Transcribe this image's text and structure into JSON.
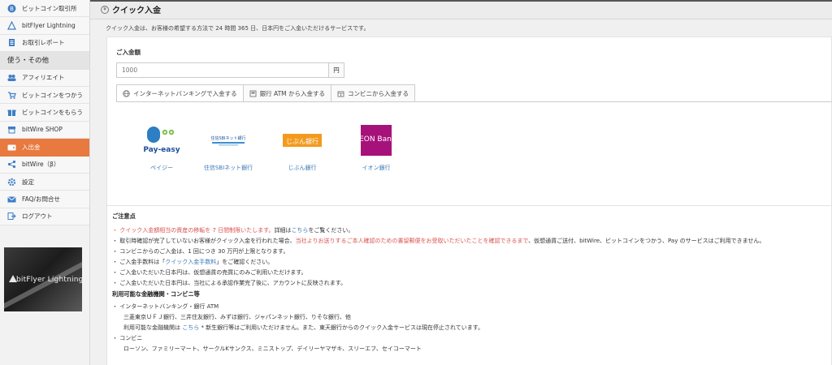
{
  "header": {
    "title": "クイック入金"
  },
  "sidebar": {
    "items": [
      {
        "label": "ビットコイン取引所",
        "icon": "bitcoin-icon"
      },
      {
        "label": "bitFlyer Lightning",
        "icon": "triangle-logo-icon"
      },
      {
        "label": "お取引レポート",
        "icon": "report-icon"
      },
      {
        "label": "使う・その他",
        "section": true
      },
      {
        "label": "アフィリエイト",
        "icon": "users-icon"
      },
      {
        "label": "ビットコインをつかう",
        "icon": "cart-icon"
      },
      {
        "label": "ビットコインをもらう",
        "icon": "gift-icon"
      },
      {
        "label": "bitWire SHOP",
        "icon": "shop-icon"
      },
      {
        "label": "入出金",
        "icon": "wallet-icon",
        "active": true
      },
      {
        "label": "bitWire（β）",
        "icon": "share-icon"
      },
      {
        "label": "設定",
        "icon": "gear-icon"
      },
      {
        "label": "FAQ/お問合せ",
        "icon": "mail-icon"
      },
      {
        "label": "ログアウト",
        "icon": "logout-icon"
      }
    ],
    "banner_text": "bitFlyer Lightning"
  },
  "main": {
    "intro": "クイック入金は、お客様の希望する方法で 24 時間 365 日、日本円をご入金いただけるサービスです。",
    "amount_label": "ご入金額",
    "amount_placeholder": "1000",
    "amount_unit": "円",
    "tabs": [
      {
        "label": "インターネットバンキングで入金する",
        "icon": "globe-icon"
      },
      {
        "label": "銀行 ATM から入金する",
        "icon": "atm-icon"
      },
      {
        "label": "コンビニから入金する",
        "icon": "store-icon"
      }
    ],
    "banks": [
      {
        "name": "ペイジー",
        "logo_text": "Pay-easy"
      },
      {
        "name": "住信SBIネット銀行",
        "logo_text": "住信SBIネット銀行"
      },
      {
        "name": "じぶん銀行",
        "logo_text": "じぶん銀行"
      },
      {
        "name": "イオン銀行",
        "logo_text": "ÆON Bank"
      }
    ]
  },
  "notes": {
    "title": "ご注意点",
    "n1_red": "・ クイック入金額相当の資産の移転を 7 日間制限いたします。",
    "n1_rest": "詳細は",
    "n1_link": "こちら",
    "n1_end": "をご覧ください。",
    "n2_a": "・ 取引時確認が完了していないお客様がクイック入金を行われた場合、",
    "n2_red": "当社よりお送りするご本人確認のための書留郵便をお受取いただいたことを確認できるまで",
    "n2_b": "、仮想通貨ご送付、bitWire、ビットコインをつかう、Pay のサービスはご利用できません。",
    "n3": "・ コンビニからのご入金は、1 回につき 30 万円が上限となります。",
    "n4_a": "・ ご入金手数料は「",
    "n4_link": "クイック入金手数料",
    "n4_b": "」をご確認ください。",
    "n5": "・ ご入金いただいた日本円は、仮想通貨の売買にのみご利用いただけます。",
    "n6": "・ ご入金いただいた日本円は、当社による承認作業完了後に、アカウントに反映されます。",
    "sub_title": "利用可能な金融機関・コンビニ等",
    "s1": "・ インターネットバンキング・銀行 ATM",
    "s1_banks": "三菱東京ＵＦＪ銀行、三井住友銀行、みずほ銀行、ジャパンネット銀行、りそな銀行、他",
    "s1_note_a": "利用可能な金融機関は",
    "s1_note_link": "こちら",
    "s1_note_b": " * 新生銀行等はご利用いただけません。また、東天銀行からのクイック入金サービスは現在停止されています。",
    "s2": "・ コンビニ",
    "s2_list": "ローソン、ファミリーマート、サークルKサンクス、ミニストップ、デイリーヤマザキ、スリーエフ、セイコーマート"
  }
}
